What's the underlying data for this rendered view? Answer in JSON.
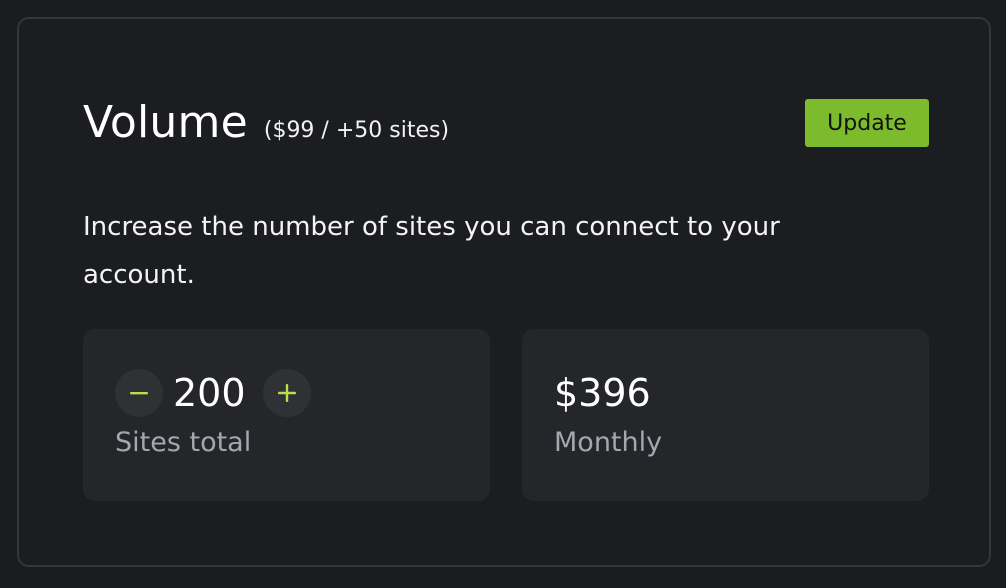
{
  "volume": {
    "title": "Volume",
    "subtitle": "($99 / +50 sites)",
    "update_label": "Update",
    "description": "Increase the number of sites you can connect to your account.",
    "sites": {
      "count": "200",
      "label": "Sites total",
      "decrement_icon": "minus-icon",
      "increment_icon": "plus-icon"
    },
    "billing": {
      "price": "$396",
      "label": "Monthly"
    }
  },
  "colors": {
    "accent": "#7cbb2c",
    "stepper_icon": "#b8e04a",
    "background": "#1c1d20",
    "panel": "#25262a",
    "muted_text": "#a3a8b0"
  }
}
